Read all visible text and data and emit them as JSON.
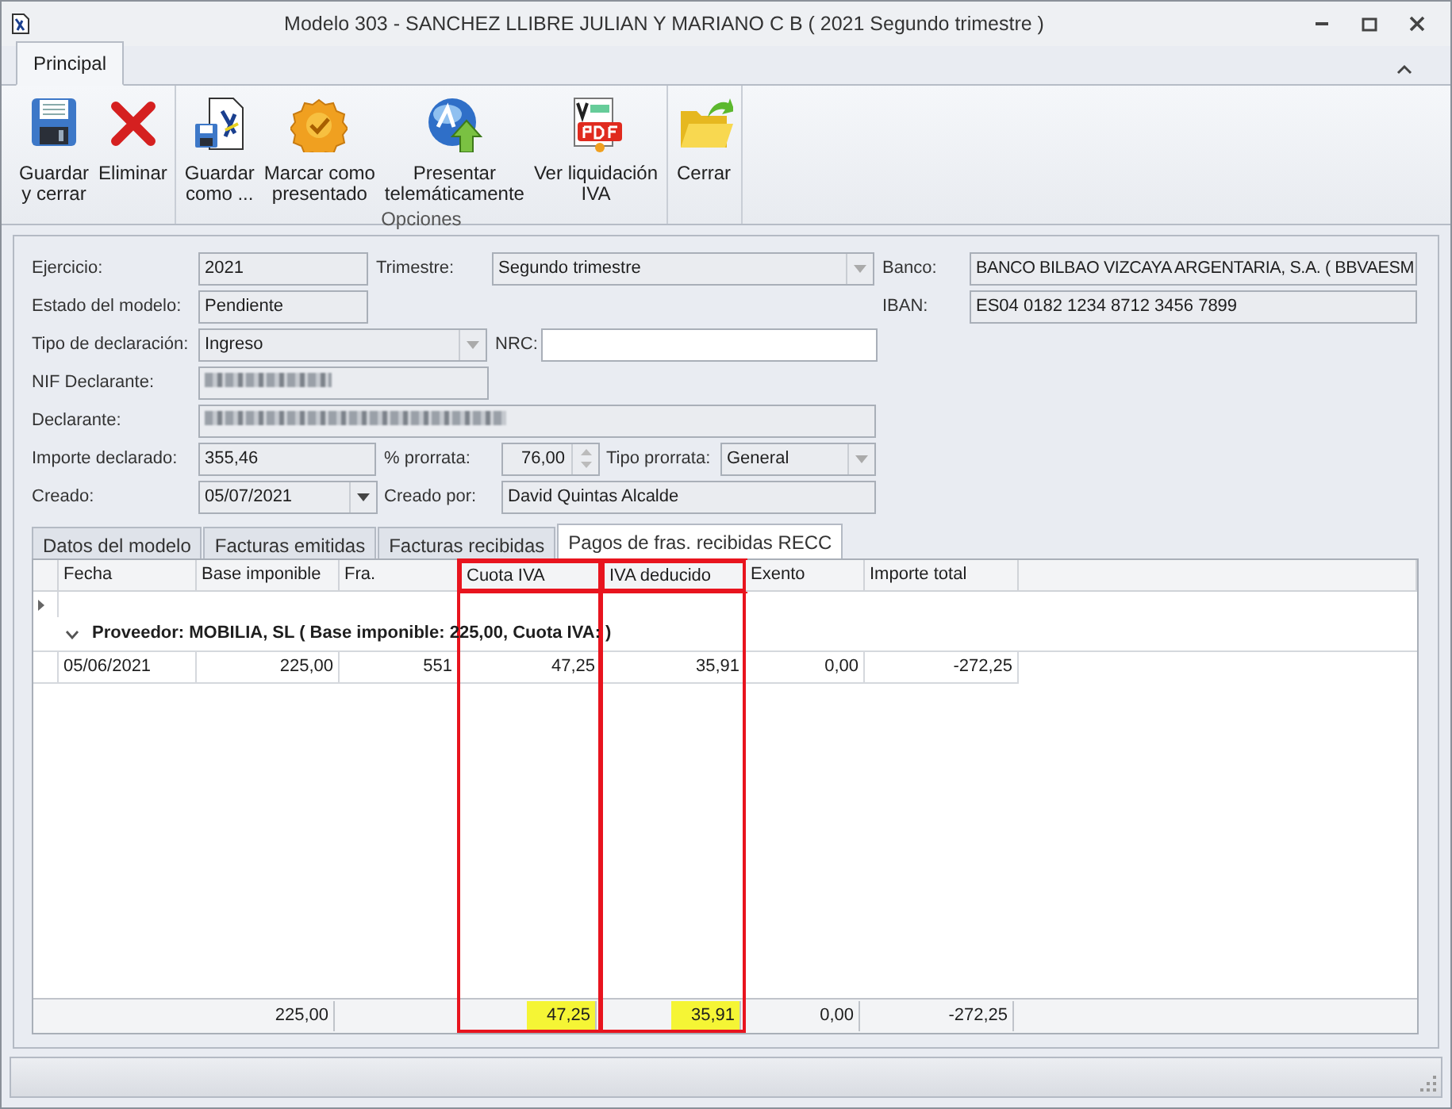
{
  "window": {
    "title": "Modelo 303 - SANCHEZ LLIBRE JULIAN Y MARIANO C B ( 2021 Segundo trimestre )"
  },
  "ribbon": {
    "tabs": [
      {
        "label": "Principal",
        "selected": true
      }
    ],
    "groups": [
      {
        "buttons": [
          {
            "kind": "save",
            "label": "Guardar\ny cerrar"
          },
          {
            "kind": "delete",
            "label": "Eliminar"
          }
        ]
      },
      {
        "label": "Opciones",
        "buttons": [
          {
            "kind": "save-as",
            "label": "Guardar\ncomo ..."
          },
          {
            "kind": "seal",
            "label": "Marcar como\npresentado"
          },
          {
            "kind": "globe",
            "label": "Presentar\ntelemáticamente"
          },
          {
            "kind": "pdf",
            "label": "Ver liquidación\nIVA"
          }
        ]
      },
      {
        "buttons": [
          {
            "kind": "folder",
            "label": "Cerrar"
          }
        ]
      }
    ]
  },
  "form": {
    "fields": [
      {
        "label": "Ejercicio:",
        "kind": "text",
        "value": "2021",
        "editable": false
      },
      {
        "label": "Trimestre:",
        "kind": "combo",
        "value": "Segundo trimestre",
        "editable": false
      },
      {
        "label": "Banco:",
        "kind": "text",
        "value": "BANCO BILBAO VIZCAYA ARGENTARIA, S.A. ( BBVAESM",
        "editable": false
      },
      {
        "label": "Estado del modelo:",
        "kind": "text",
        "value": "Pendiente",
        "editable": false
      },
      {
        "label": "IBAN:",
        "kind": "text",
        "value": "ES04 0182 1234 8712 3456 7899",
        "editable": false
      },
      {
        "label": "Tipo de declaración:",
        "kind": "combo",
        "value": "Ingreso",
        "editable": false
      },
      {
        "label": "NRC:",
        "kind": "text",
        "editable": true
      },
      {
        "label": "NIF Declarante:",
        "kind": "text",
        "redacted": true,
        "editable": false
      },
      {
        "label": "Declarante:",
        "kind": "text",
        "redacted": true,
        "editable": false
      },
      {
        "label": "Importe declarado:",
        "kind": "text",
        "value": "355,46",
        "editable": false
      },
      {
        "label": "% prorrata:",
        "kind": "spin",
        "value": "76,00",
        "editable": false
      },
      {
        "label": "Tipo prorrata:",
        "kind": "combo",
        "value": "General",
        "editable": false
      },
      {
        "label": "Creado:",
        "kind": "date",
        "value": "05/07/2021",
        "editable": false
      },
      {
        "label": "Creado por:",
        "kind": "text",
        "value": "David Quintas Alcalde",
        "editable": false
      }
    ]
  },
  "tabs": [
    {
      "label": "Datos del modelo",
      "selected": false
    },
    {
      "label": "Facturas emitidas",
      "selected": false
    },
    {
      "label": "Facturas recibidas",
      "selected": false
    },
    {
      "label": "Pagos de fras. recibidas RECC",
      "selected": true
    }
  ],
  "table": {
    "columns": [
      {
        "label": "Fecha",
        "highlighted": false
      },
      {
        "label": "Base imponible",
        "highlighted": false,
        "total": "225,00"
      },
      {
        "label": "Fra.",
        "highlighted": false
      },
      {
        "label": "Cuota IVA",
        "highlighted": true,
        "total": "47,25"
      },
      {
        "label": "IVA deducido",
        "highlighted": true,
        "total": "35,91"
      },
      {
        "label": "Exento",
        "highlighted": false,
        "total": "0,00"
      },
      {
        "label": "Importe total",
        "highlighted": false,
        "total": "-272,25"
      }
    ],
    "groups": [
      {
        "label": "Proveedor: MOBILIA, SL ( Base imponible: 225,00, Cuota IVA:  )",
        "expanded": true,
        "rows": [
          {
            "cells": [
              "05/06/2021",
              "225,00",
              "551",
              "47,25",
              "35,91",
              "0,00",
              "-272,25"
            ]
          }
        ]
      }
    ]
  }
}
